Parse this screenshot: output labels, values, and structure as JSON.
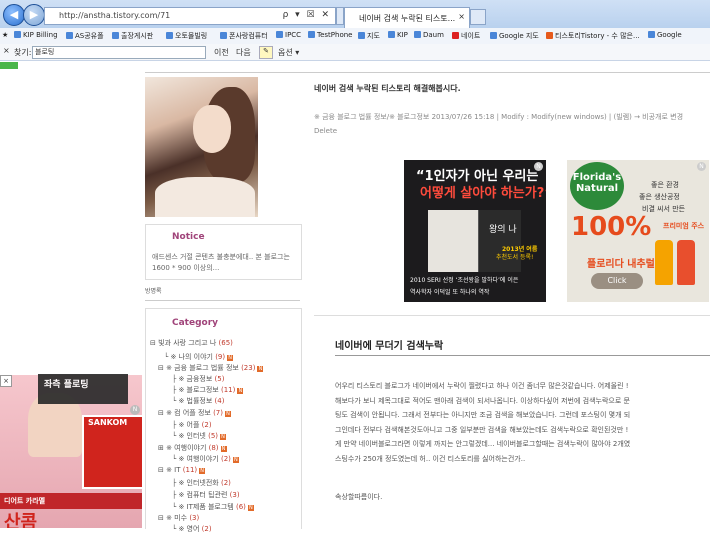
{
  "browser": {
    "url": "http://anstha.tistory.com/71",
    "address_controls": "ρ ▾ ☒ ✕",
    "tab_title": "네이버 검색 누락된 티스토...",
    "tab_close": "×",
    "back_glyph": "◀",
    "forward_glyph": "▶",
    "favorites": [
      "KIP Billing",
      "AS공유폴",
      "출장게시판",
      "오토몰빌링",
      "폰사랑컴퓨터",
      "IPCC",
      "TestPhone",
      "지도",
      "KIP",
      "Daum",
      "네이트",
      "Google 지도",
      "티스토리Tistory - 수 많은...",
      "Google"
    ],
    "find": {
      "close": "×",
      "label": "찾기:",
      "value": "블로팅",
      "prev": "이전",
      "next": "다음",
      "options": "옵션 ▾"
    }
  },
  "sidebar": {
    "notice_title": "Notice",
    "notice_text": "애드센스 거절 콘텐츠 불충분에대.. 본 블로그는 1600 * 900 이상의...",
    "visitors_label": "방명록",
    "category_title": "Category",
    "categories": [
      {
        "label": "빛과 사랑 그리고 나",
        "count": "(65)"
      },
      {
        "label": "※ 나의 이야기",
        "count": "(9)"
      },
      {
        "label": "※ 금융 블로그 법률 정보",
        "count": "(23)"
      },
      {
        "label": "※ 금융정보",
        "count": "(5)"
      },
      {
        "label": "※ 블로그정보",
        "count": "(11)"
      },
      {
        "label": "※ 법률정보",
        "count": "(4)"
      },
      {
        "label": "※ 컴 어플 정보",
        "count": "(7)"
      },
      {
        "label": "※ 어플",
        "count": "(2)"
      },
      {
        "label": "※ 인터넷",
        "count": "(5)"
      },
      {
        "label": "※ 여행이야기",
        "count": "(8)"
      },
      {
        "label": "※ 여행이야기",
        "count": "(2)"
      },
      {
        "label": "※ IT",
        "count": "(11)"
      },
      {
        "label": "※ 인터넷전화",
        "count": "(2)"
      },
      {
        "label": "※ 컴퓨터 팁관련",
        "count": "(3)"
      },
      {
        "label": "※ IT제품 블로그템",
        "count": "(6)"
      },
      {
        "label": "※ 미수",
        "count": "(3)"
      },
      {
        "label": "※ 영어",
        "count": "(2)"
      }
    ]
  },
  "post": {
    "title": "네이버 검색 누락된 티스토리 해결해봅시다.",
    "meta_line1": "※ 금융 블로그 법률 정보/※ 블로그정보 2013/07/26 15:18 | Modify : Modify(new windows) | (빌렘) → 비공개로 변경",
    "meta_line2": "Delete",
    "section_title": "네이버에 무더기 검색누락",
    "body": [
      "어우리 티스토리 블로그가 네이버에서 누락이 찔렸다고 하나 이건 좀너무 많은것같습니다. 어제올린 !",
      "해보다가 보니 제목그대로 적어도 맨아래 검색이 되서나옵니다. 이상하다싶어 저번에 검색누락으로 문",
      "팅도 검색이 안됩니다. 그래서 전부다는 아니지만 조금 검색을 해보았습니다. 그런데 포스팅이 몇개 되",
      "그인데다 전부다 검색해본것도아니고 그중 일부분만 검색을 해보았는데도 검색누락으로 확인된것만 !",
      "게 만약 네이버블로그라면 이렇게 까지는 안그렇겠데... 네이버블로그할때는 검색누락이 많아야 2개였",
      "스팅수가 250개 정도였는데 허.. 이건 티스토리를 싫어하는건가.."
    ],
    "ending": "속상할따름이다."
  },
  "ads": {
    "book_ad": {
      "headline1": "“1인자가 아닌 우리는",
      "headline2": "어떻게 살아야 하는가?”",
      "book_title": "왕의 나",
      "ribbon1": "2013년 여름",
      "ribbon2": "추천도서 등록!",
      "footer1": "2010 SERI 선정 ‘조선왕을 말하다’에 이은",
      "footer2": "역사학자 이덕일 또 하나의 역작"
    },
    "juice_ad": {
      "logo": "Florida's Natural",
      "line1": "좋은 환경",
      "line2": "좋은 생산공정",
      "line3": "비결 씨서 만든",
      "percent": "100%",
      "line4": "프리미엄 주스",
      "campaign": "플로리다 내추럴",
      "cta": "Click"
    },
    "badge": "N",
    "float_ad": {
      "close": "×",
      "tooltip": "좌측 플로팅",
      "brand": "SANKOM",
      "bar_text": "디어트 카라멜",
      "big_text": "산콤"
    }
  },
  "colors": {
    "accent": "#a0447a",
    "ad_orange": "#e64b1c",
    "float_red": "#d0241d"
  }
}
